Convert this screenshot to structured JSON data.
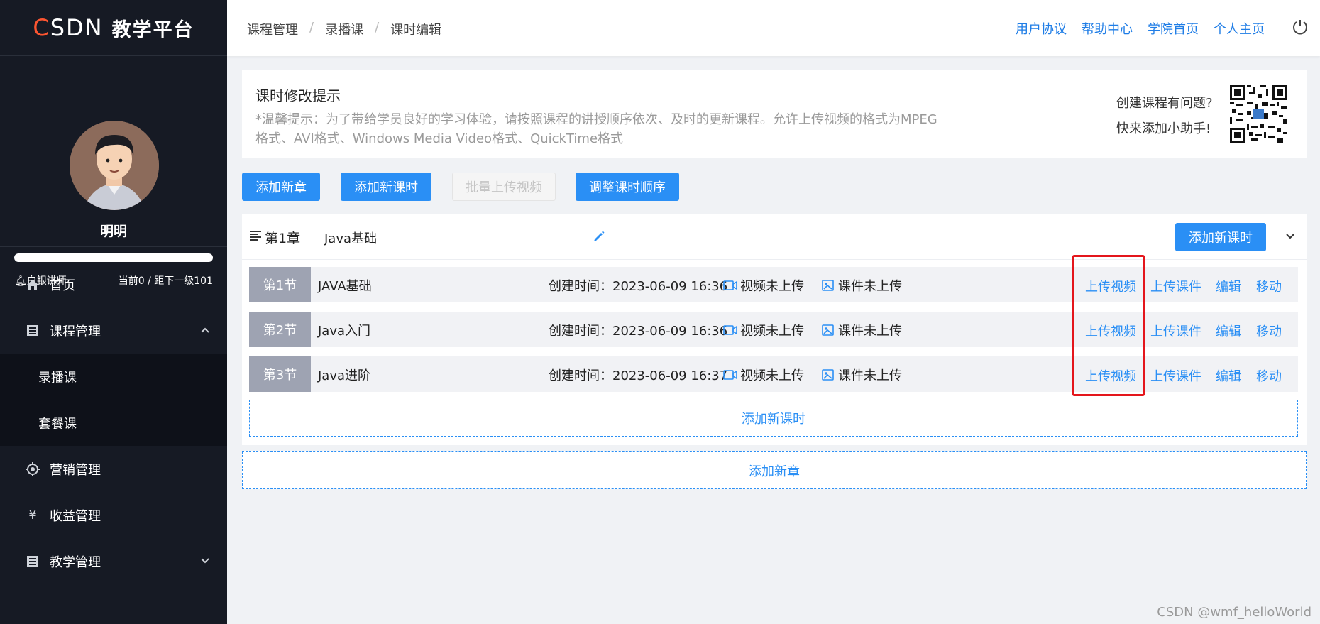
{
  "sidebar": {
    "logo_brand_c": "C",
    "logo_brand_rest": "SDN",
    "logo_title": "教学平台",
    "username": "明明",
    "rank": "白银讲师",
    "level_text": "当前0 / 距下一级101",
    "progress": 0,
    "menu": {
      "home": "首页",
      "course_mgmt": "课程管理",
      "recorded": "录播课",
      "package": "套餐课",
      "marketing": "营销管理",
      "revenue": "收益管理",
      "teaching": "教学管理"
    }
  },
  "topbar": {
    "breadcrumb": [
      "课程管理",
      "录播课",
      "课时编辑"
    ],
    "breadcrumb_sep": "/",
    "links": [
      "用户协议",
      "帮助中心",
      "学院首页",
      "个人主页"
    ]
  },
  "tip": {
    "title": "课时修改提示",
    "text": "*温馨提示：为了带给学员良好的学习体验，请按照课程的讲授顺序依次、及时的更新课程。允许上传视频的格式为MPEG格式、AVI格式、Windows Media Video格式、QuickTime格式",
    "helper_line1": "创建课程有问题?",
    "helper_line2": "快来添加小助手!"
  },
  "actions": {
    "add_chapter": "添加新章",
    "add_lesson": "添加新课时",
    "batch_upload": "批量上传视频",
    "reorder": "调整课时顺序"
  },
  "chapter": {
    "number": "第1章",
    "name": "Java基础",
    "add_lesson": "添加新课时",
    "lessons": [
      {
        "tag": "第1节",
        "name": "JAVA基础",
        "time": "创建时间：2023-06-09 16:36",
        "video": "视频未上传",
        "ware": "课件未上传"
      },
      {
        "tag": "第2节",
        "name": "Java入门",
        "time": "创建时间：2023-06-09 16:36",
        "video": "视频未上传",
        "ware": "课件未上传"
      },
      {
        "tag": "第3节",
        "name": "Java进阶",
        "time": "创建时间：2023-06-09 16:37",
        "video": "视频未上传",
        "ware": "课件未上传"
      }
    ],
    "lesson_actions": {
      "upload_video": "上传视频",
      "upload_ware": "上传课件",
      "edit": "编辑",
      "move": "移动"
    },
    "add_lesson_bottom": "添加新课时"
  },
  "add_chapter_bottom": "添加新章",
  "watermark": "CSDN @wmf_helloWorld",
  "colors": {
    "primary": "#2a8ff5",
    "sidebar_bg": "#161a24",
    "highlight": "#e4161c",
    "brand_red": "#fc5531"
  }
}
